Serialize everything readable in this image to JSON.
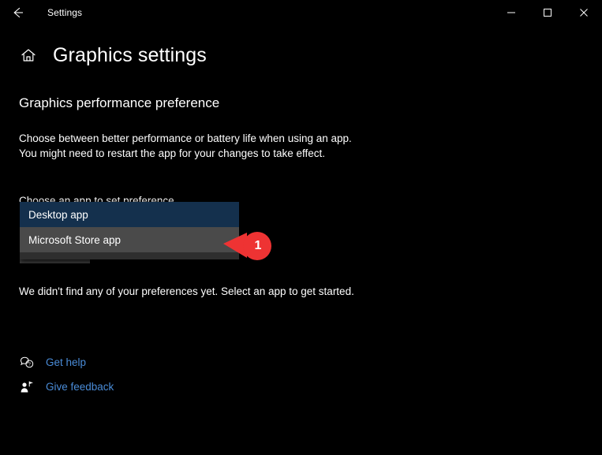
{
  "window": {
    "titlebar_title": "Settings",
    "back_icon": "arrow-left-icon",
    "minimize_label": "Minimize",
    "maximize_label": "Maximize",
    "close_label": "Close"
  },
  "header": {
    "home_icon": "home-icon",
    "title": "Graphics settings"
  },
  "main": {
    "section_heading": "Graphics performance preference",
    "description_line1": "Choose between better performance or battery life when using an app.",
    "description_line2": "You might need to restart the app for your changes to take effect.",
    "field_label": "Choose an app to set preference",
    "status_text": "We didn't find any of your preferences yet. Select an app to get started."
  },
  "dropdown": {
    "name": "app-type-dropdown",
    "expanded": true,
    "selected_value": "Desktop app",
    "options": [
      {
        "label": "Desktop app",
        "state": "selected"
      },
      {
        "label": "Microsoft Store app",
        "state": "hovered"
      }
    ]
  },
  "callout": {
    "number": "1",
    "color": "#ee3333"
  },
  "footer": {
    "links": [
      {
        "label": "Get help",
        "icon": "help-bubble-icon"
      },
      {
        "label": "Give feedback",
        "icon": "feedback-person-icon"
      }
    ]
  },
  "colors": {
    "background": "#000000",
    "selected_option": "#14304d",
    "hovered_option": "#4a4a4a",
    "popup_background": "#2b2b2b",
    "link": "#4a8cd8",
    "callout_red": "#ee3333"
  }
}
